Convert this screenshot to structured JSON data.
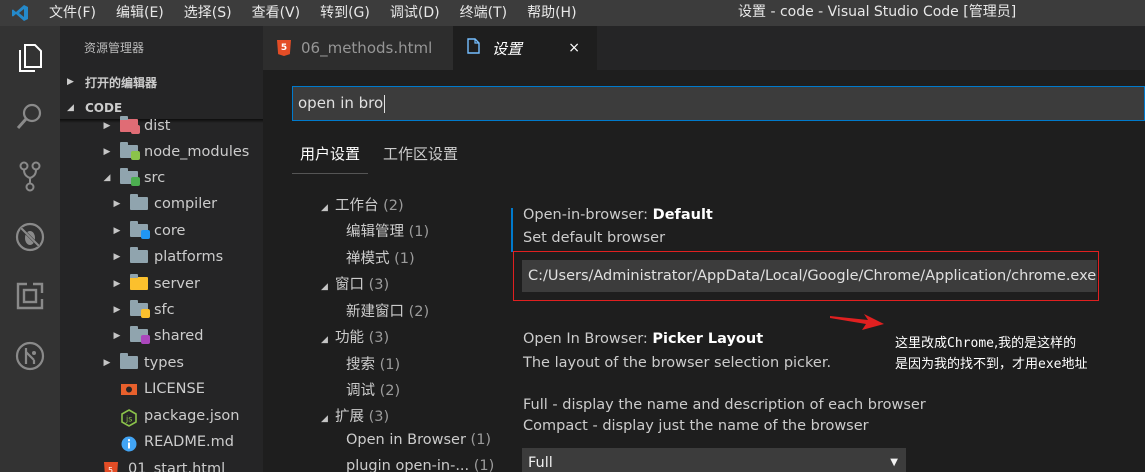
{
  "window": {
    "title": "设置 - code - Visual Studio Code [管理员]",
    "menu": [
      "文件(F)",
      "编辑(E)",
      "选择(S)",
      "查看(V)",
      "转到(G)",
      "调试(D)",
      "终端(T)",
      "帮助(H)"
    ]
  },
  "sidebar": {
    "title": "资源管理器",
    "open_editors": "打开的编辑器",
    "workspace": "CODE",
    "tree": [
      {
        "label": "dist",
        "expanded": false,
        "type": "folder",
        "badge_color": "#e06c75"
      },
      {
        "label": "node_modules",
        "expanded": false,
        "type": "folder",
        "badge_color": "#8bc34a"
      },
      {
        "label": "src",
        "expanded": true,
        "type": "folder",
        "badge_color": "#4caf50"
      },
      {
        "label": "compiler",
        "expanded": false,
        "type": "folder",
        "badge_color": ""
      },
      {
        "label": "core",
        "expanded": false,
        "type": "folder",
        "badge_color": "#2196f3"
      },
      {
        "label": "platforms",
        "expanded": false,
        "type": "folder",
        "badge_color": ""
      },
      {
        "label": "server",
        "expanded": false,
        "type": "folder",
        "badge_color": "#fbc02d"
      },
      {
        "label": "sfc",
        "expanded": false,
        "type": "folder",
        "badge_color": "#fbc02d"
      },
      {
        "label": "shared",
        "expanded": false,
        "type": "folder",
        "badge_color": "#ab47bc"
      },
      {
        "label": "types",
        "expanded": false,
        "type": "folder",
        "badge_color": ""
      },
      {
        "label": "LICENSE",
        "type": "license-file"
      },
      {
        "label": "package.json",
        "type": "json-file"
      },
      {
        "label": "README.md",
        "type": "readme-file"
      },
      {
        "label": "01_start.html",
        "type": "html-file"
      }
    ]
  },
  "tabs": [
    {
      "label": "06_methods.html",
      "active": false
    },
    {
      "label": "设置",
      "active": true,
      "close": "×"
    }
  ],
  "settings": {
    "search_value": "open in bro",
    "scope_tabs": [
      "用户设置",
      "工作区设置"
    ],
    "toc": [
      {
        "label": "工作台",
        "count": "(2)",
        "level": 0
      },
      {
        "label": "编辑管理",
        "count": "(1)",
        "level": 1
      },
      {
        "label": "禅模式",
        "count": "(1)",
        "level": 1
      },
      {
        "label": "窗口",
        "count": "(3)",
        "level": 0
      },
      {
        "label": "新建窗口",
        "count": "(2)",
        "level": 1
      },
      {
        "label": "功能",
        "count": "(3)",
        "level": 0
      },
      {
        "label": "搜索",
        "count": "(1)",
        "level": 1
      },
      {
        "label": "调试",
        "count": "(2)",
        "level": 1
      },
      {
        "label": "扩展",
        "count": "(3)",
        "level": 0
      },
      {
        "label": "Open in Browser",
        "count": "(1)",
        "level": 1
      },
      {
        "label": "plugin open-in-...",
        "count": "(1)",
        "level": 1
      }
    ],
    "default_browser": {
      "category": "Open-in-browser: ",
      "name": "Default",
      "description": "Set default browser",
      "value": "C:/Users/Administrator/AppData/Local/Google/Chrome/Application/chrome.exe"
    },
    "picker_layout": {
      "category": "Open In Browser: ",
      "name": "Picker Layout",
      "description": "The layout of the browser selection picker.",
      "option_full": "Full - display the name and description of each browser",
      "option_compact": "Compact - display just the name of the browser",
      "selected": "Full"
    }
  },
  "annotation": {
    "line1_a": "这里改成",
    "line1_b": "Chrome",
    "line1_c": ",我的是这样的",
    "line2_a": "是因为我的找不到，才用",
    "line2_b": "exe",
    "line2_c": "地址"
  }
}
